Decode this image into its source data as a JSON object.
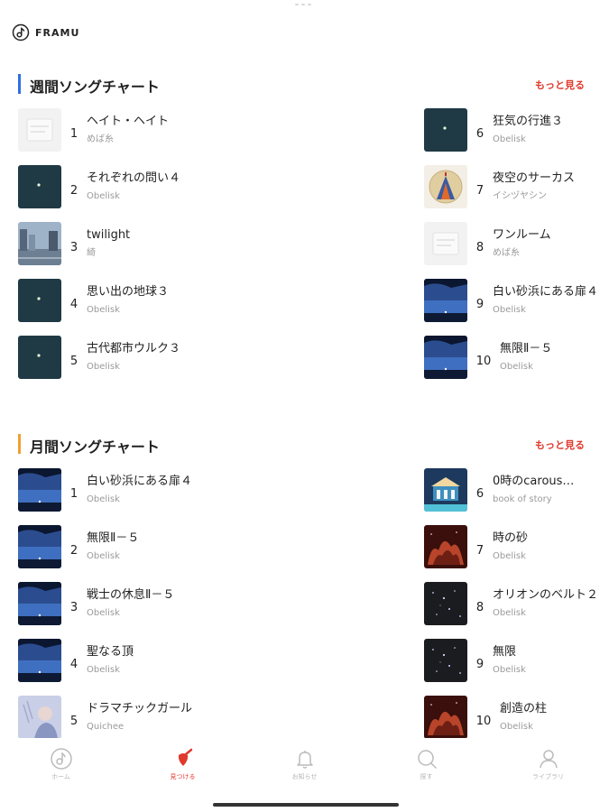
{
  "app": {
    "logo_text": "FRAMU"
  },
  "weekly": {
    "title": "週間ソングチャート",
    "more_label": "もっと見る",
    "accent": "#2f6fe0",
    "items": [
      {
        "rank": "1",
        "title": "ヘイト・ヘイト",
        "artist": "めば糸",
        "art": "white"
      },
      {
        "rank": "2",
        "title": "それぞれの問い４",
        "artist": "Obelisk",
        "art": "dark-teal"
      },
      {
        "rank": "3",
        "title": "twilight",
        "artist": "綺",
        "art": "city"
      },
      {
        "rank": "4",
        "title": "思い出の地球３",
        "artist": "Obelisk",
        "art": "dark-teal"
      },
      {
        "rank": "5",
        "title": "古代都市ウルク３",
        "artist": "Obelisk",
        "art": "dark-teal"
      },
      {
        "rank": "6",
        "title": "狂気の行進３",
        "artist": "Obelisk",
        "art": "dark-teal"
      },
      {
        "rank": "7",
        "title": "夜空のサーカス",
        "artist": "イシヅヤシン",
        "art": "circus"
      },
      {
        "rank": "8",
        "title": "ワンルーム",
        "artist": "めば糸",
        "art": "white"
      },
      {
        "rank": "9",
        "title": "白い砂浜にある扉４",
        "artist": "Obelisk",
        "art": "sky"
      },
      {
        "rank": "10",
        "title": "無限Ⅱ－５",
        "artist": "Obelisk",
        "art": "sky"
      }
    ]
  },
  "monthly": {
    "title": "月間ソングチャート",
    "more_label": "もっと見る",
    "accent": "#f0a030",
    "items": [
      {
        "rank": "1",
        "title": "白い砂浜にある扉４",
        "artist": "Obelisk",
        "art": "sky"
      },
      {
        "rank": "2",
        "title": "無限Ⅱ－５",
        "artist": "Obelisk",
        "art": "sky"
      },
      {
        "rank": "3",
        "title": "戦士の休息Ⅱ－５",
        "artist": "Obelisk",
        "art": "sky"
      },
      {
        "rank": "4",
        "title": "聖なる頂",
        "artist": "Obelisk",
        "art": "sky"
      },
      {
        "rank": "5",
        "title": "ドラマチックガール",
        "artist": "Quichee",
        "art": "girl"
      },
      {
        "rank": "6",
        "title": "0時のcarous…",
        "artist": "book of story",
        "art": "carousel"
      },
      {
        "rank": "7",
        "title": "時の砂",
        "artist": "Obelisk",
        "art": "nebula"
      },
      {
        "rank": "8",
        "title": "オリオンのベルト２",
        "artist": "Obelisk",
        "art": "stars"
      },
      {
        "rank": "9",
        "title": "無限",
        "artist": "Obelisk",
        "art": "stars"
      },
      {
        "rank": "10",
        "title": "創造の柱",
        "artist": "Obelisk",
        "art": "nebula"
      }
    ]
  },
  "tabbar": {
    "active_color": "#e0392d",
    "tabs": [
      {
        "label": "ホーム",
        "icon": "music-note-icon"
      },
      {
        "label": "見つける",
        "icon": "guitar-pick-icon"
      },
      {
        "label": "お知らせ",
        "icon": "bell-icon"
      },
      {
        "label": "探す",
        "icon": "search-icon"
      },
      {
        "label": "ライブラリ",
        "icon": "person-icon"
      }
    ]
  }
}
